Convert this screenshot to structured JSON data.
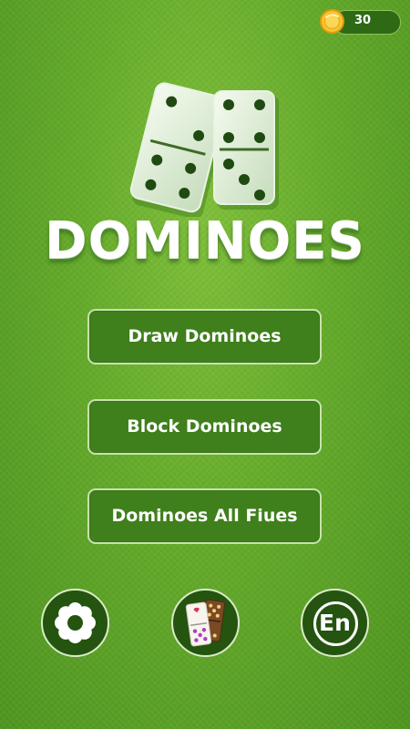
{
  "header": {
    "coins": "30",
    "coin_icon": "gold-coin-icon"
  },
  "logo": {
    "title": "DOMINOES",
    "icon": "domino-tiles-icon"
  },
  "menu": {
    "draw_label": "Draw Dominoes",
    "block_label": "Block Dominoes",
    "allfives_label": "Dominoes All Fiues"
  },
  "footer": {
    "settings_icon": "gear-icon",
    "skins_icon": "domino-skins-icon",
    "language_label": "En"
  },
  "colors": {
    "background": "#64aa2a",
    "button_fill": "#3f7f1c",
    "button_border": "#c8e2ae",
    "round_button_fill": "#24540f",
    "coin_gold": "#f2b81c"
  }
}
